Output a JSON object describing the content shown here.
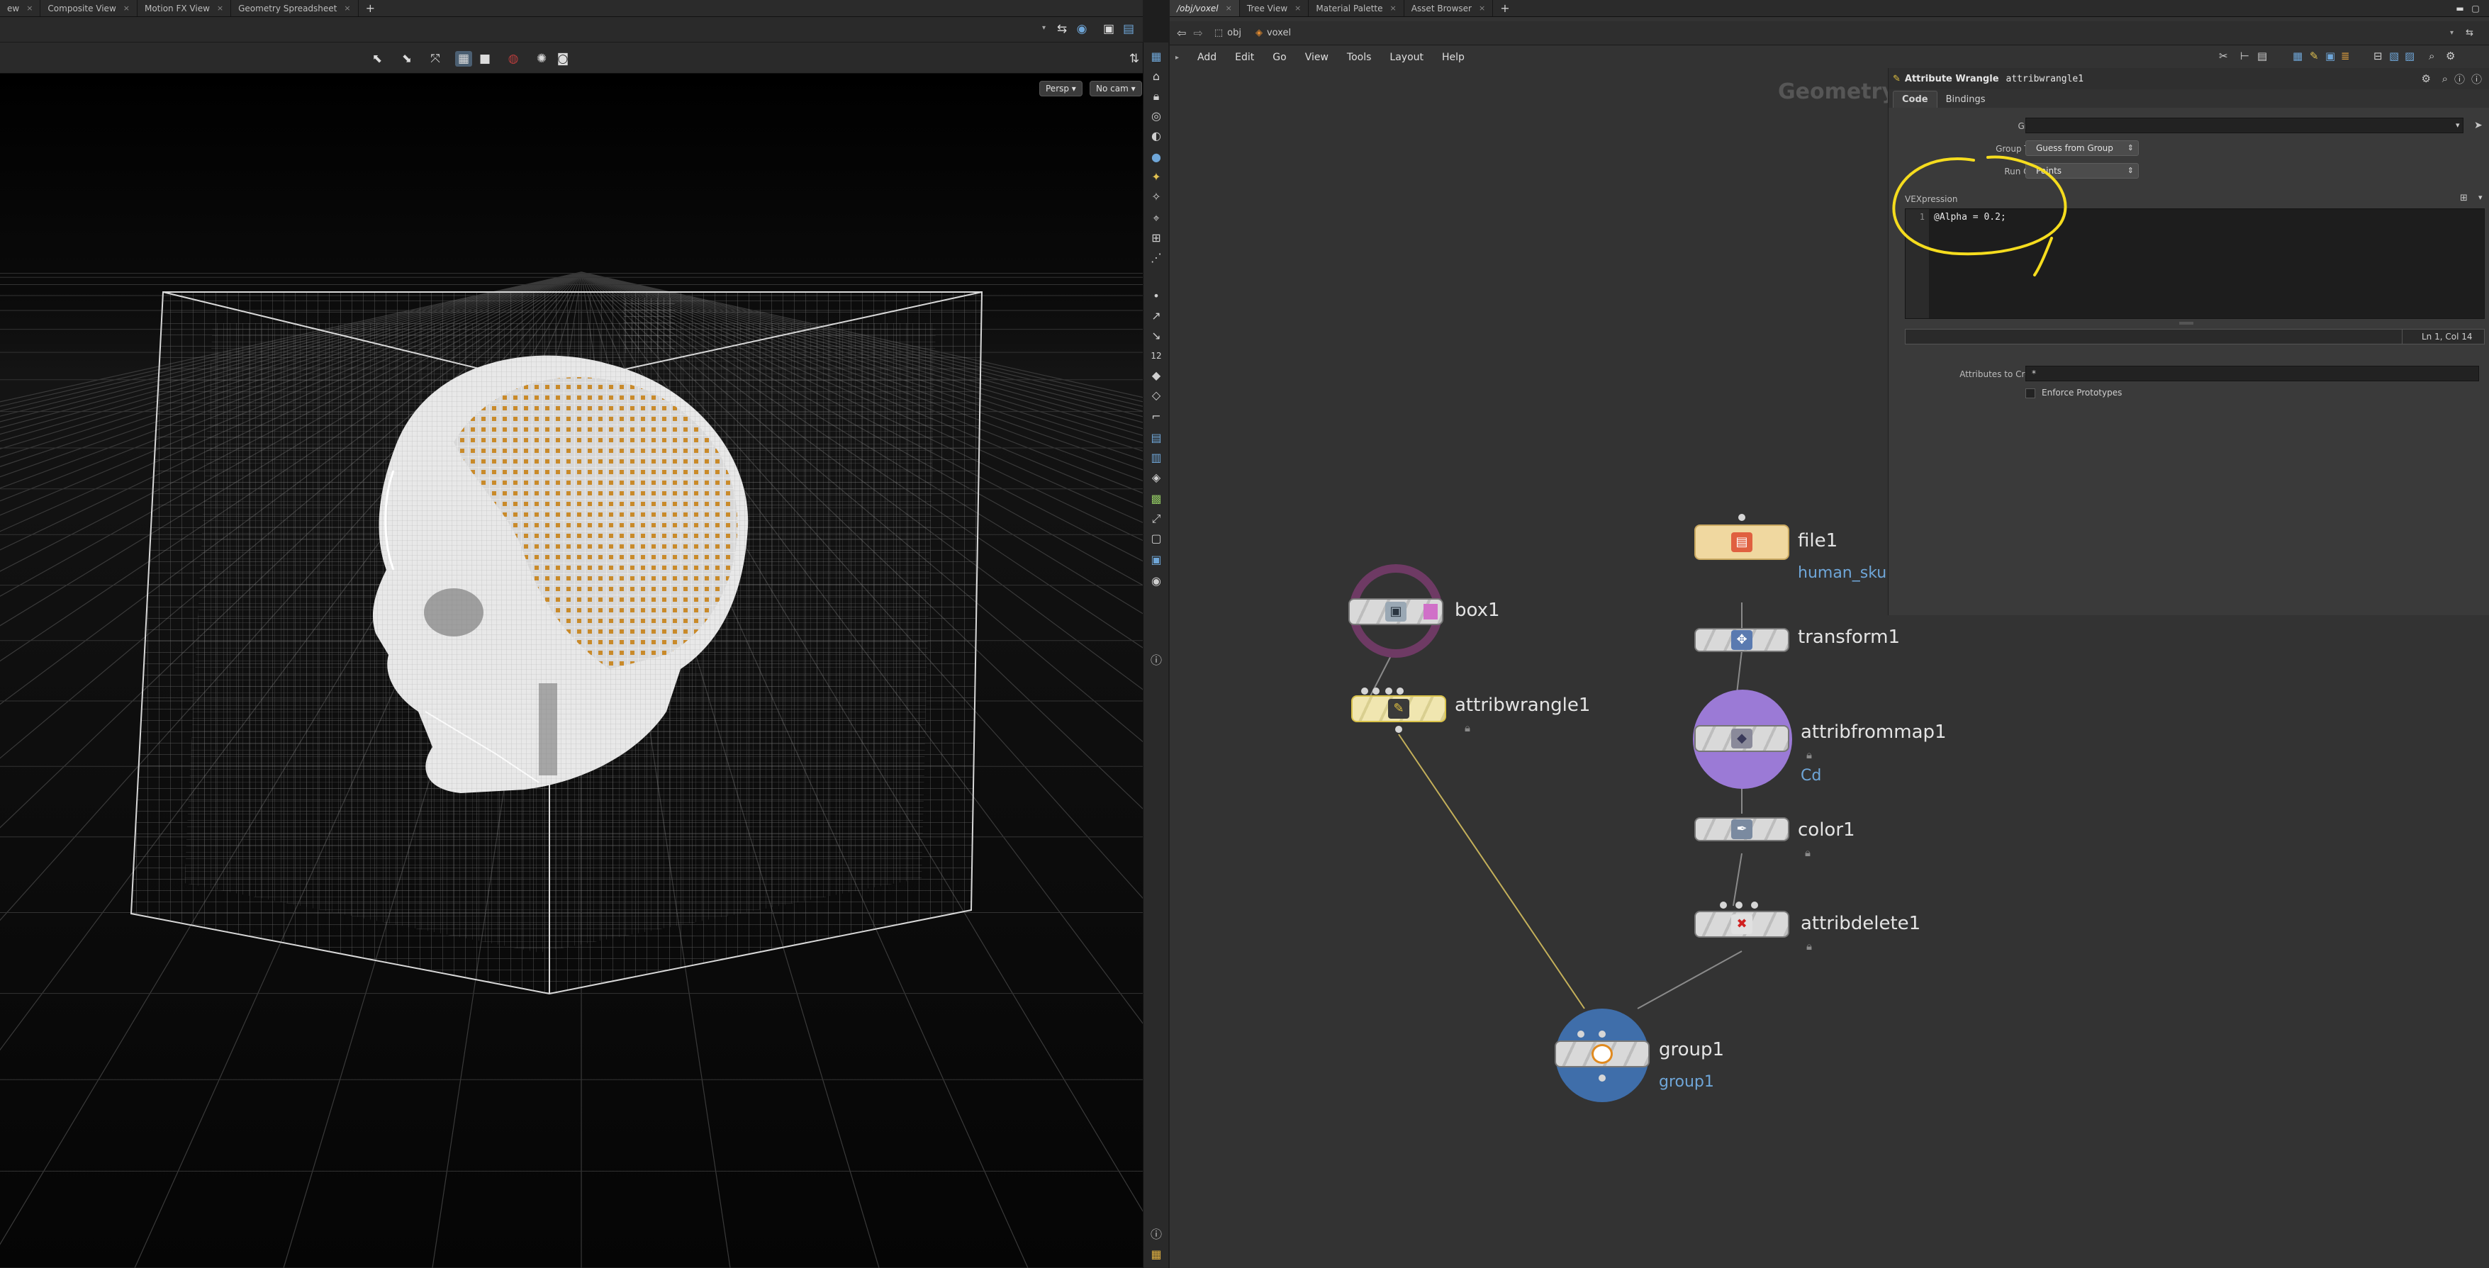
{
  "left_pane": {
    "tabs": [
      {
        "label": "ew"
      },
      {
        "label": "Composite View"
      },
      {
        "label": "Motion FX View"
      },
      {
        "label": "Geometry Spreadsheet"
      }
    ],
    "viewport": {
      "camera_mode": "Persp ▾",
      "camera": "No cam ▾"
    }
  },
  "right_pane": {
    "tabs": [
      {
        "label": "/obj/voxel",
        "active": true
      },
      {
        "label": "Tree View"
      },
      {
        "label": "Material Palette"
      },
      {
        "label": "Asset Browser"
      }
    ],
    "path": {
      "root": "obj",
      "current": "voxel"
    },
    "menu": [
      "Add",
      "Edit",
      "Go",
      "View",
      "Tools",
      "Layout",
      "Help"
    ],
    "context_label": "Geometry",
    "nodes": {
      "box1": {
        "label": "box1"
      },
      "attribwrangle1": {
        "label": "attribwrangle1"
      },
      "file1": {
        "label": "file1",
        "sub": "human_sku"
      },
      "transform1": {
        "label": "transform1"
      },
      "attribfrommap1": {
        "label": "attribfrommap1",
        "sub": "Cd"
      },
      "color1": {
        "label": "color1"
      },
      "attribdelete1": {
        "label": "attribdelete1"
      },
      "group1": {
        "label": "group1",
        "sub": "group1"
      }
    }
  },
  "params": {
    "node_type": "Attribute Wrangle",
    "node_name": "attribwrangle1",
    "tabs": [
      "Code",
      "Bindings"
    ],
    "group_label": "Group",
    "group_value": "",
    "group_type_label": "Group Type",
    "group_type_value": "Guess from Group",
    "run_over_label": "Run Over",
    "run_over_value": "Points",
    "vexpression_label": "VEXpression",
    "code_line_number": "1",
    "code_text": "@Alpha = 0.2;",
    "cursor_status": "Ln 1, Col 14",
    "attributes_to_create_label": "Attributes to Create",
    "attributes_to_create_value": "*",
    "enforce_prototypes_label": "Enforce Prototypes"
  },
  "colors": {
    "annotation": "#f5dc1e",
    "bone_points": "#c98a2a",
    "node_link": "#6fa6d8",
    "box_ring": "#6e3a64",
    "group_ring": "#3f6eaa",
    "attribfrommap_ring": "#9b7ad6"
  }
}
